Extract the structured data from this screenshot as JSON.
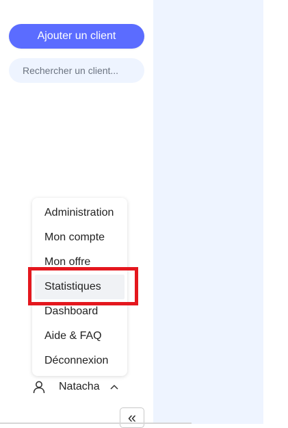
{
  "sidebar": {
    "add_client_label": "Ajouter un client",
    "search_placeholder": "Rechercher un client...",
    "menu": [
      {
        "label": "Administration"
      },
      {
        "label": "Mon compte"
      },
      {
        "label": "Mon offre"
      },
      {
        "label": "Statistiques",
        "hovered": true
      },
      {
        "label": "Dashboard"
      },
      {
        "label": "Aide & FAQ"
      },
      {
        "label": "Déconnexion"
      }
    ],
    "user": {
      "name": "Natacha",
      "icon": "user-icon",
      "chevron": "chevron-up-icon"
    },
    "collapse_glyph": "«",
    "collapse_icon": "double-chevron-left-icon"
  },
  "colors": {
    "accent": "#5b6cff",
    "panel_bg": "#eef4ff",
    "highlight_border": "#e4171e"
  }
}
